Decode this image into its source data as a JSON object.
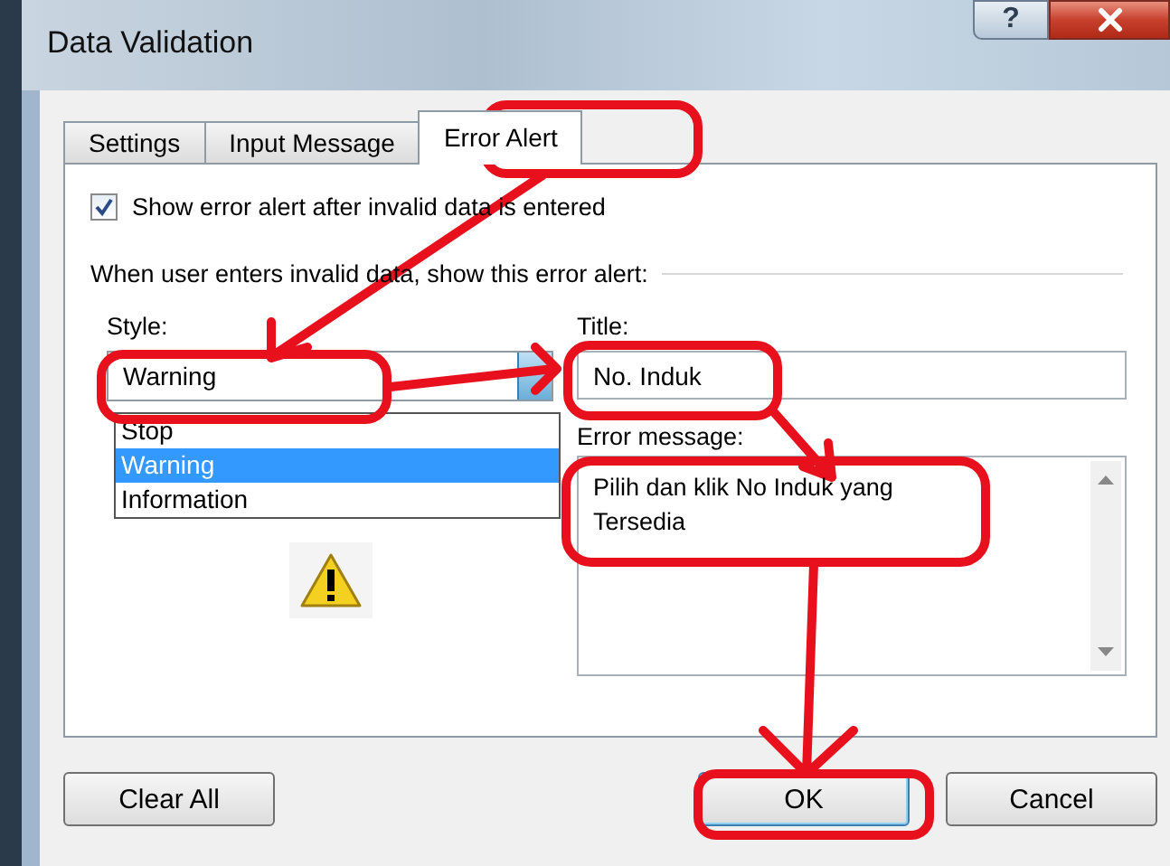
{
  "window": {
    "title": "Data Validation",
    "help": "?"
  },
  "tabs": [
    {
      "label": "Settings",
      "selected": false
    },
    {
      "label": "Input Message",
      "selected": false
    },
    {
      "label": "Error Alert",
      "selected": true
    }
  ],
  "show_alert": {
    "label": "Show error alert after invalid data is entered",
    "checked": true
  },
  "section_label": "When user enters invalid data, show this error alert:",
  "style": {
    "label": "Style:",
    "value": "Warning",
    "options": [
      {
        "label": "Stop",
        "selected": false
      },
      {
        "label": "Warning",
        "selected": true
      },
      {
        "label": "Information",
        "selected": false
      }
    ]
  },
  "title": {
    "label": "Title:",
    "value": "No. Induk"
  },
  "error_message": {
    "label": "Error message:",
    "value": "Pilih dan klik No Induk yang Tersedia"
  },
  "buttons": [
    {
      "label": "Clear All",
      "default": false
    },
    {
      "label": "OK",
      "default": true
    },
    {
      "label": "Cancel",
      "default": false
    }
  ]
}
